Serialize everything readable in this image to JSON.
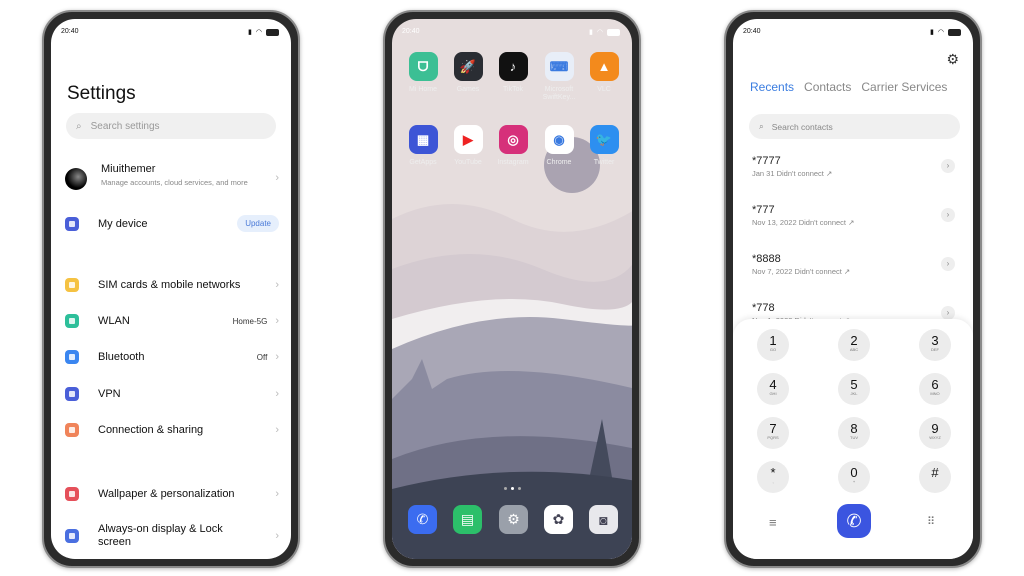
{
  "status_time": "20:40",
  "settings": {
    "title": "Settings",
    "search_placeholder": "Search settings",
    "account": {
      "name": "Miuithemer",
      "subtitle": "Manage accounts, cloud services, and more"
    },
    "my_device": {
      "label": "My device",
      "badge": "Update"
    },
    "items": [
      {
        "label": "SIM cards & mobile networks",
        "value": "",
        "color": "#f5c242"
      },
      {
        "label": "WLAN",
        "value": "Home-5G",
        "color": "#2dbf9a"
      },
      {
        "label": "Bluetooth",
        "value": "Off",
        "color": "#3a86f0"
      },
      {
        "label": "VPN",
        "value": "",
        "color": "#4a5fd8"
      },
      {
        "label": "Connection & sharing",
        "value": "",
        "color": "#f0845a"
      },
      {
        "label": "Wallpaper & personalization",
        "value": "",
        "color": "#e5505a"
      },
      {
        "label": "Always-on display & Lock screen",
        "value": "",
        "color": "#4a6fe0"
      }
    ]
  },
  "home": {
    "apps": [
      {
        "name": "Mi Home",
        "color": "#3cbf94",
        "glyph": "ᗜ"
      },
      {
        "name": "Games",
        "color": "#2a2d33",
        "glyph": "🚀"
      },
      {
        "name": "TikTok",
        "color": "#111",
        "glyph": "♪"
      },
      {
        "name": "Microsoft SwiftKey...",
        "color": "#e8eef8",
        "glyph": "⌨"
      },
      {
        "name": "VLC",
        "color": "#f38a1c",
        "glyph": "▲"
      },
      {
        "name": "GetApps",
        "color": "#3d55d6",
        "glyph": "▦"
      },
      {
        "name": "YouTube",
        "color": "#fff",
        "glyph": "▶"
      },
      {
        "name": "Instagram",
        "color": "#d6307a",
        "glyph": "◎"
      },
      {
        "name": "Chrome",
        "color": "#fff",
        "glyph": "◉"
      },
      {
        "name": "Twitter",
        "color": "#2d8ff0",
        "glyph": "🐦"
      }
    ],
    "dock": [
      {
        "name": "phone-icon",
        "color": "#3b6cf0",
        "glyph": "✆"
      },
      {
        "name": "messages-icon",
        "color": "#2cbf6a",
        "glyph": "▤"
      },
      {
        "name": "settings-icon",
        "color": "#9aa0aa",
        "glyph": "⚙"
      },
      {
        "name": "photos-icon",
        "color": "#fff",
        "glyph": "✿"
      },
      {
        "name": "camera-icon",
        "color": "#e8e8ec",
        "glyph": "◙"
      }
    ]
  },
  "dialer": {
    "tabs": [
      "Recents",
      "Contacts",
      "Carrier Services"
    ],
    "accent": "#3b7de0",
    "search_placeholder": "Search contacts",
    "recents": [
      {
        "number": "*7777",
        "detail": "Jan 31 Didn't connect ↗"
      },
      {
        "number": "*777",
        "detail": "Nov 13, 2022 Didn't connect ↗"
      },
      {
        "number": "*8888",
        "detail": "Nov 7, 2022 Didn't connect ↗"
      },
      {
        "number": "*778",
        "detail": "Nov 1, 2022 Didn't connect ↗"
      }
    ],
    "keys": [
      [
        "1",
        "GO"
      ],
      [
        "2",
        "ABC"
      ],
      [
        "3",
        "DEF"
      ],
      [
        "4",
        "GHI"
      ],
      [
        "5",
        "JKL"
      ],
      [
        "6",
        "MNO"
      ],
      [
        "7",
        "PQRS"
      ],
      [
        "8",
        "TUV"
      ],
      [
        "9",
        "WXYZ"
      ],
      [
        "*",
        ","
      ],
      [
        "0",
        "+"
      ],
      [
        "#",
        ""
      ]
    ]
  }
}
